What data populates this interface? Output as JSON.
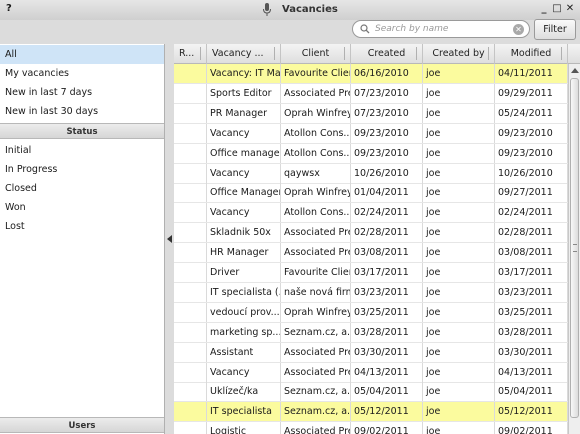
{
  "window": {
    "title": "Vacancies",
    "help_label": "?",
    "minimize_label": "_",
    "maximize_label": "□",
    "close_label": "✕"
  },
  "toolbar": {
    "search_placeholder": "Search by name",
    "clear_label": "✕",
    "filter_label": "Filter"
  },
  "sidebar": {
    "views": [
      {
        "label": "All",
        "selected": true
      },
      {
        "label": "My vacancies"
      },
      {
        "label": "New in last 7 days"
      },
      {
        "label": "New in last 30 days"
      }
    ],
    "status_header": "Status",
    "statuses": [
      {
        "label": "Initial"
      },
      {
        "label": "In Progress"
      },
      {
        "label": "Closed"
      },
      {
        "label": "Won"
      },
      {
        "label": "Lost"
      }
    ],
    "users_header": "Users"
  },
  "table": {
    "columns": [
      "R...",
      "Vacancy ...",
      "Client",
      "Created",
      "Created by",
      "Modified"
    ],
    "rows": [
      {
        "vacancy": "Vacancy: IT Ma...",
        "client": "Favourite Client",
        "created": "06/16/2010",
        "created_by": "joe",
        "modified": "04/11/2011",
        "highlight": true
      },
      {
        "vacancy": "Sports Editor",
        "client": "Associated Press",
        "created": "07/23/2010",
        "created_by": "joe",
        "modified": "09/29/2011"
      },
      {
        "vacancy": "PR Manager",
        "client": "Oprah Winfrey...",
        "created": "07/23/2010",
        "created_by": "joe",
        "modified": "05/24/2011"
      },
      {
        "vacancy": "Vacancy",
        "client": "Atollon Cons...",
        "created": "09/23/2010",
        "created_by": "joe",
        "modified": "09/23/2010"
      },
      {
        "vacancy": "Office manager",
        "client": "Atollon Cons...",
        "created": "09/23/2010",
        "created_by": "joe",
        "modified": "09/23/2010"
      },
      {
        "vacancy": "Vacancy",
        "client": "qaywsx",
        "created": "10/26/2010",
        "created_by": "joe",
        "modified": "10/26/2010"
      },
      {
        "vacancy": "Office Manager",
        "client": "Oprah Winfrey...",
        "created": "01/04/2011",
        "created_by": "joe",
        "modified": "09/27/2011"
      },
      {
        "vacancy": "Vacancy",
        "client": "Atollon Cons...",
        "created": "02/24/2011",
        "created_by": "joe",
        "modified": "02/24/2011"
      },
      {
        "vacancy": "Skladnik 50x",
        "client": "Associated Press",
        "created": "02/28/2011",
        "created_by": "joe",
        "modified": "02/28/2011"
      },
      {
        "vacancy": "HR Manager",
        "client": "Associated Press",
        "created": "03/08/2011",
        "created_by": "joe",
        "modified": "03/08/2011"
      },
      {
        "vacancy": "Driver",
        "client": "Favourite Client",
        "created": "03/17/2011",
        "created_by": "joe",
        "modified": "03/17/2011"
      },
      {
        "vacancy": "IT specialista (...",
        "client": "naše nová firma",
        "created": "03/23/2011",
        "created_by": "joe",
        "modified": "03/23/2011"
      },
      {
        "vacancy": "vedoucí prov...",
        "client": "Oprah Winfrey...",
        "created": "03/25/2011",
        "created_by": "joe",
        "modified": "03/25/2011"
      },
      {
        "vacancy": "marketing sp...",
        "client": "Seznam.cz, a.s.",
        "created": "03/28/2011",
        "created_by": "joe",
        "modified": "03/28/2011"
      },
      {
        "vacancy": "Assistant",
        "client": "Associated Press",
        "created": "03/30/2011",
        "created_by": "joe",
        "modified": "03/30/2011"
      },
      {
        "vacancy": "Vacancy",
        "client": "Associated Press",
        "created": "04/13/2011",
        "created_by": "joe",
        "modified": "04/13/2011"
      },
      {
        "vacancy": "Uklízeč/ka",
        "client": "Seznam.cz, a.s.",
        "created": "05/04/2011",
        "created_by": "joe",
        "modified": "05/04/2011"
      },
      {
        "vacancy": "IT specialista",
        "client": "Seznam.cz, a.s.",
        "created": "05/12/2011",
        "created_by": "joe",
        "modified": "05/12/2011",
        "highlight": true
      },
      {
        "vacancy": "Logistic",
        "client": "Associated Press",
        "created": "09/02/2011",
        "created_by": "joe",
        "modified": "09/02/2011"
      }
    ]
  },
  "colors": {
    "highlight": "#fbfb9e",
    "selected": "#cfe4f7"
  }
}
